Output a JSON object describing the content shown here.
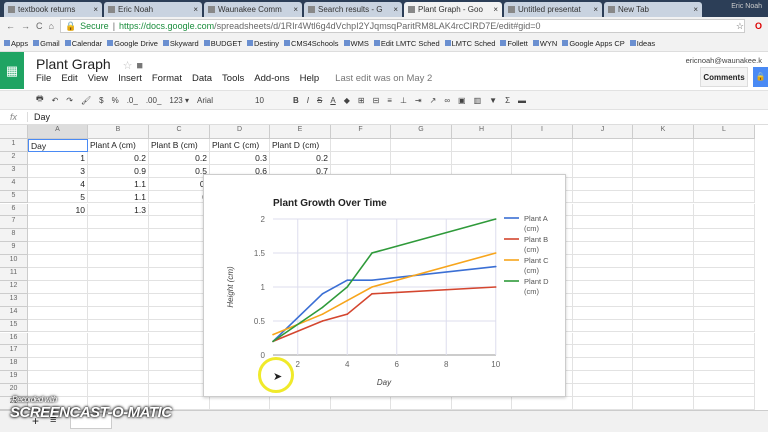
{
  "browser": {
    "tabs": [
      {
        "label": "textbook returns",
        "icon": "gmail-icon"
      },
      {
        "label": "Eric Noah",
        "icon": "facebook-icon"
      },
      {
        "label": "Waunakee Comm",
        "icon": "w-icon"
      },
      {
        "label": "Search results - G",
        "icon": "drive-icon"
      },
      {
        "label": "Plant Graph - Goo",
        "icon": "sheets-icon",
        "active": true
      },
      {
        "label": "Untitled presentat",
        "icon": "slides-icon"
      },
      {
        "label": "New Tab",
        "icon": ""
      }
    ],
    "user_badge": "Eric Noah",
    "secure": "Secure",
    "url_host": "https://docs.google.com",
    "url_path": "/spreadsheets/d/1RIr4Wtl6g4dVchpI2YJqmsqParitRM8LAK4rcCIRD7E/edit#gid=0",
    "bookmarks": [
      "Apps",
      "Gmail",
      "Calendar",
      "Google Drive",
      "Skyward",
      "BUDGET",
      "Destiny",
      "CMS4Schools",
      "WMS",
      "Edit LMTC Sched",
      "LMTC Sched",
      "Follett",
      "WYN",
      "Google Apps CP",
      "Ideas"
    ]
  },
  "sheets": {
    "title": "Plant Graph",
    "menu": [
      "File",
      "Edit",
      "View",
      "Insert",
      "Format",
      "Data",
      "Tools",
      "Add-ons",
      "Help"
    ],
    "last_edit": "Last edit was on May 2",
    "user_email": "ericnoah@waunakee.k",
    "comments": "Comments",
    "toolbar": {
      "currency": "$",
      "percent": "%",
      "dec_less": ".0_",
      "dec_more": ".00_",
      "format": "123 ▾",
      "font": "Arial",
      "size": "10",
      "bold": "B",
      "italic": "I",
      "strike": "S",
      "text_color": "A"
    },
    "formula_label": "fx",
    "formula_value": "Day",
    "columns": [
      "A",
      "B",
      "C",
      "D",
      "E",
      "F",
      "G",
      "H",
      "I",
      "J",
      "K",
      "L"
    ],
    "rows": [
      [
        "Day",
        "Plant A (cm)",
        "Plant B (cm)",
        "Plant C (cm)",
        "Plant D (cm)"
      ],
      [
        "1",
        "0.2",
        "0.2",
        "0.3",
        "0.2"
      ],
      [
        "3",
        "0.9",
        "0.5",
        "0.6",
        "0.7"
      ],
      [
        "4",
        "1.1",
        "0.",
        "",
        ""
      ],
      [
        "5",
        "1.1",
        "0",
        "",
        ""
      ],
      [
        "10",
        "1.3",
        "",
        "",
        ""
      ]
    ],
    "row_count": 21
  },
  "chart_data": {
    "type": "line",
    "title": "Plant Growth Over Time",
    "xlabel": "Day",
    "ylabel": "Height (cm)",
    "x": [
      1,
      3,
      4,
      5,
      10
    ],
    "xlim": [
      1,
      10
    ],
    "ylim": [
      0,
      2
    ],
    "xticks": [
      "2",
      "4",
      "6",
      "8",
      "10"
    ],
    "yticks": [
      "0",
      "0.5",
      "1",
      "1.5",
      "2"
    ],
    "grid": true,
    "legend": "right",
    "series": [
      {
        "name": "Plant A (cm)",
        "l1": "Plant A",
        "l2": "(cm)",
        "color": "#3b6fd4",
        "values": [
          0.2,
          0.9,
          1.1,
          1.1,
          1.3
        ]
      },
      {
        "name": "Plant B (cm)",
        "l1": "Plant B",
        "l2": "(cm)",
        "color": "#d4462f",
        "values": [
          0.2,
          0.5,
          0.6,
          0.9,
          1.0
        ]
      },
      {
        "name": "Plant C (cm)",
        "l1": "Plant C",
        "l2": "(cm)",
        "color": "#f7a51c",
        "values": [
          0.3,
          0.6,
          0.8,
          1.0,
          1.5
        ]
      },
      {
        "name": "Plant D (cm)",
        "l1": "Plant D",
        "l2": "(cm)",
        "color": "#2f9a3a",
        "values": [
          0.2,
          0.7,
          1.0,
          1.5,
          2.0
        ]
      }
    ]
  },
  "watermark": {
    "line1": "Recorded with",
    "line2": "SCREENCAST-O-MATIC"
  }
}
